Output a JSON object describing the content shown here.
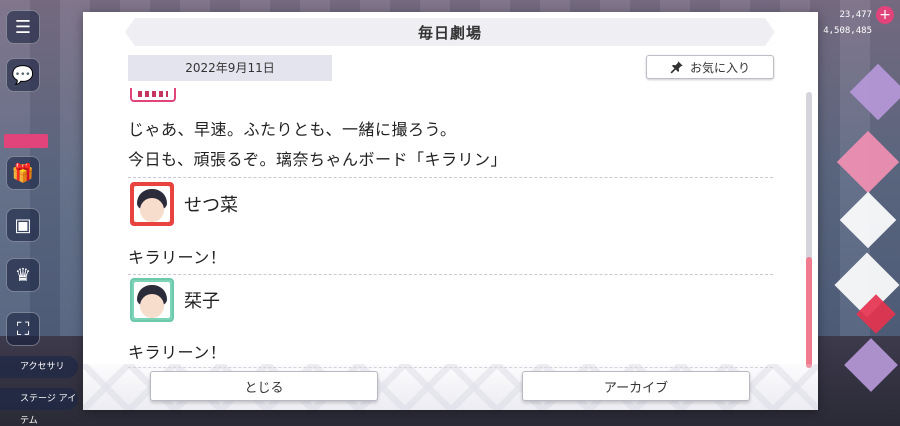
{
  "background": {
    "stats": [
      "23,477",
      "4,508,485"
    ],
    "left_tags": [
      "",
      ""
    ],
    "bottom_chips": [
      "アクセサリ",
      "ステージ アイテム"
    ]
  },
  "modal": {
    "title": "毎日劇場",
    "date": "2022年9月11日",
    "favorite_label": "お気に入り",
    "lines": [
      "じゃあ、早速。ふたりとも、一緒に撮ろう。",
      "今日も、頑張るぞ。璃奈ちゃんボード「キラリン」"
    ],
    "entries": [
      {
        "speaker": "せつ菜",
        "text": "キラリーン！"
      },
      {
        "speaker": "栞子",
        "text": "キラリーン！"
      }
    ],
    "close_label": "とじる",
    "archive_label": "アーカイブ"
  },
  "colors": {
    "accent": "#e0447a",
    "scroll_thumb": "#f07a8e",
    "setsuna": "#e8433f",
    "shioriko": "#7cd3b7"
  },
  "icons": [
    "menu-icon",
    "chat-icon",
    "gift-icon",
    "photo-icon",
    "trophy-icon",
    "fullscreen-icon",
    "pin-icon",
    "plus-icon"
  ]
}
